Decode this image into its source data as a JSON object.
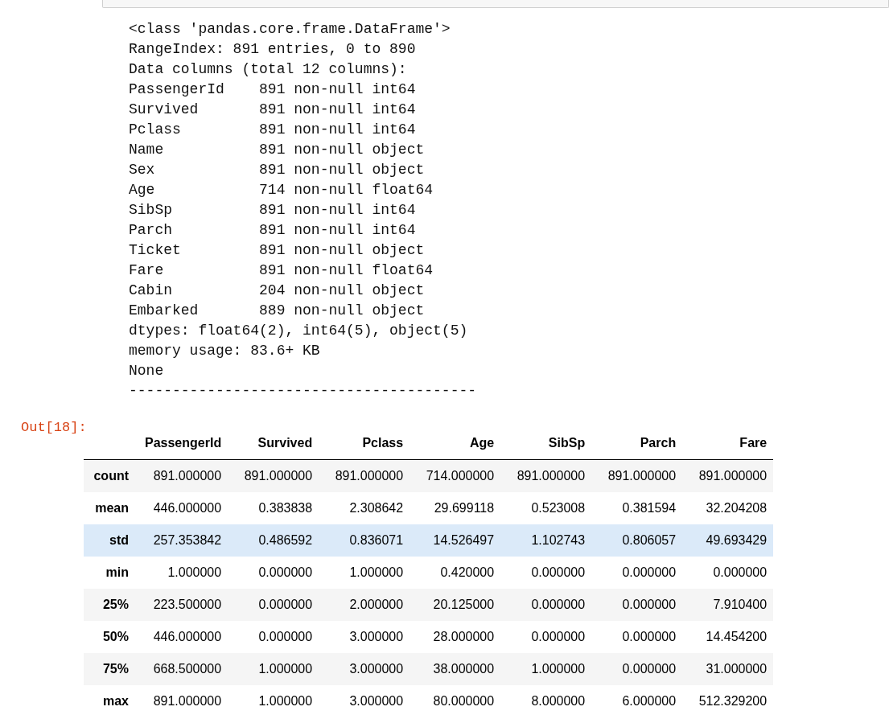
{
  "output_text": [
    "<class 'pandas.core.frame.DataFrame'>",
    "RangeIndex: 891 entries, 0 to 890",
    "Data columns (total 12 columns):",
    "PassengerId    891 non-null int64",
    "Survived       891 non-null int64",
    "Pclass         891 non-null int64",
    "Name           891 non-null object",
    "Sex            891 non-null object",
    "Age            714 non-null float64",
    "SibSp          891 non-null int64",
    "Parch          891 non-null int64",
    "Ticket         891 non-null object",
    "Fare           891 non-null float64",
    "Cabin          204 non-null object",
    "Embarked       889 non-null object",
    "dtypes: float64(2), int64(5), object(5)",
    "memory usage: 83.6+ KB",
    "None",
    "----------------------------------------"
  ],
  "out_prompt": "Out[18]:",
  "table": {
    "columns": [
      "PassengerId",
      "Survived",
      "Pclass",
      "Age",
      "SibSp",
      "Parch",
      "Fare"
    ],
    "rows": [
      {
        "label": "count",
        "selected": false,
        "cells": [
          "891.000000",
          "891.000000",
          "891.000000",
          "714.000000",
          "891.000000",
          "891.000000",
          "891.000000"
        ]
      },
      {
        "label": "mean",
        "selected": false,
        "cells": [
          "446.000000",
          "0.383838",
          "2.308642",
          "29.699118",
          "0.523008",
          "0.381594",
          "32.204208"
        ]
      },
      {
        "label": "std",
        "selected": true,
        "cells": [
          "257.353842",
          "0.486592",
          "0.836071",
          "14.526497",
          "1.102743",
          "0.806057",
          "49.693429"
        ]
      },
      {
        "label": "min",
        "selected": false,
        "cells": [
          "1.000000",
          "0.000000",
          "1.000000",
          "0.420000",
          "0.000000",
          "0.000000",
          "0.000000"
        ]
      },
      {
        "label": "25%",
        "selected": false,
        "cells": [
          "223.500000",
          "0.000000",
          "2.000000",
          "20.125000",
          "0.000000",
          "0.000000",
          "7.910400"
        ]
      },
      {
        "label": "50%",
        "selected": false,
        "cells": [
          "446.000000",
          "0.000000",
          "3.000000",
          "28.000000",
          "0.000000",
          "0.000000",
          "14.454200"
        ]
      },
      {
        "label": "75%",
        "selected": false,
        "cells": [
          "668.500000",
          "1.000000",
          "3.000000",
          "38.000000",
          "1.000000",
          "0.000000",
          "31.000000"
        ]
      },
      {
        "label": "max",
        "selected": false,
        "cells": [
          "891.000000",
          "1.000000",
          "3.000000",
          "80.000000",
          "8.000000",
          "6.000000",
          "512.329200"
        ]
      }
    ]
  }
}
